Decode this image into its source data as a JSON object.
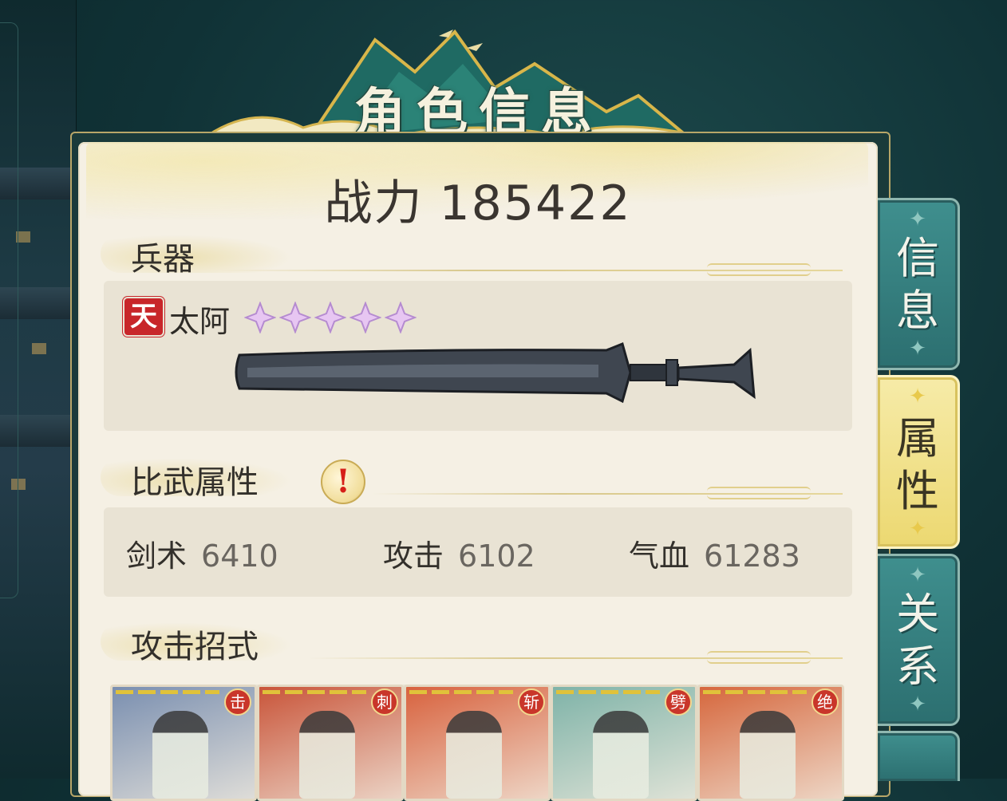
{
  "title": "角色信息",
  "combat_power": {
    "label": "战力",
    "value": "185422"
  },
  "weapon_section": {
    "heading": "兵器",
    "grade": "天",
    "name": "太阿",
    "stars": 5
  },
  "attributes_section": {
    "heading": "比武属性",
    "alert": "!",
    "stats": [
      {
        "label": "剑术",
        "value": "6410"
      },
      {
        "label": "攻击",
        "value": "6102"
      },
      {
        "label": "气血",
        "value": "61283"
      }
    ]
  },
  "moves_section": {
    "heading": "攻击招式",
    "moves": [
      {
        "tag": "击",
        "color": "#7a8fb0"
      },
      {
        "tag": "刺",
        "color": "#c9553a"
      },
      {
        "tag": "斩",
        "color": "#d8623e"
      },
      {
        "tag": "劈",
        "color": "#7fb3a8"
      },
      {
        "tag": "绝",
        "color": "#d6673d"
      }
    ]
  },
  "side_tabs": [
    {
      "label_1": "信",
      "label_2": "息",
      "active": false
    },
    {
      "label_1": "属",
      "label_2": "性",
      "active": true
    },
    {
      "label_1": "关",
      "label_2": "系",
      "active": false
    }
  ]
}
